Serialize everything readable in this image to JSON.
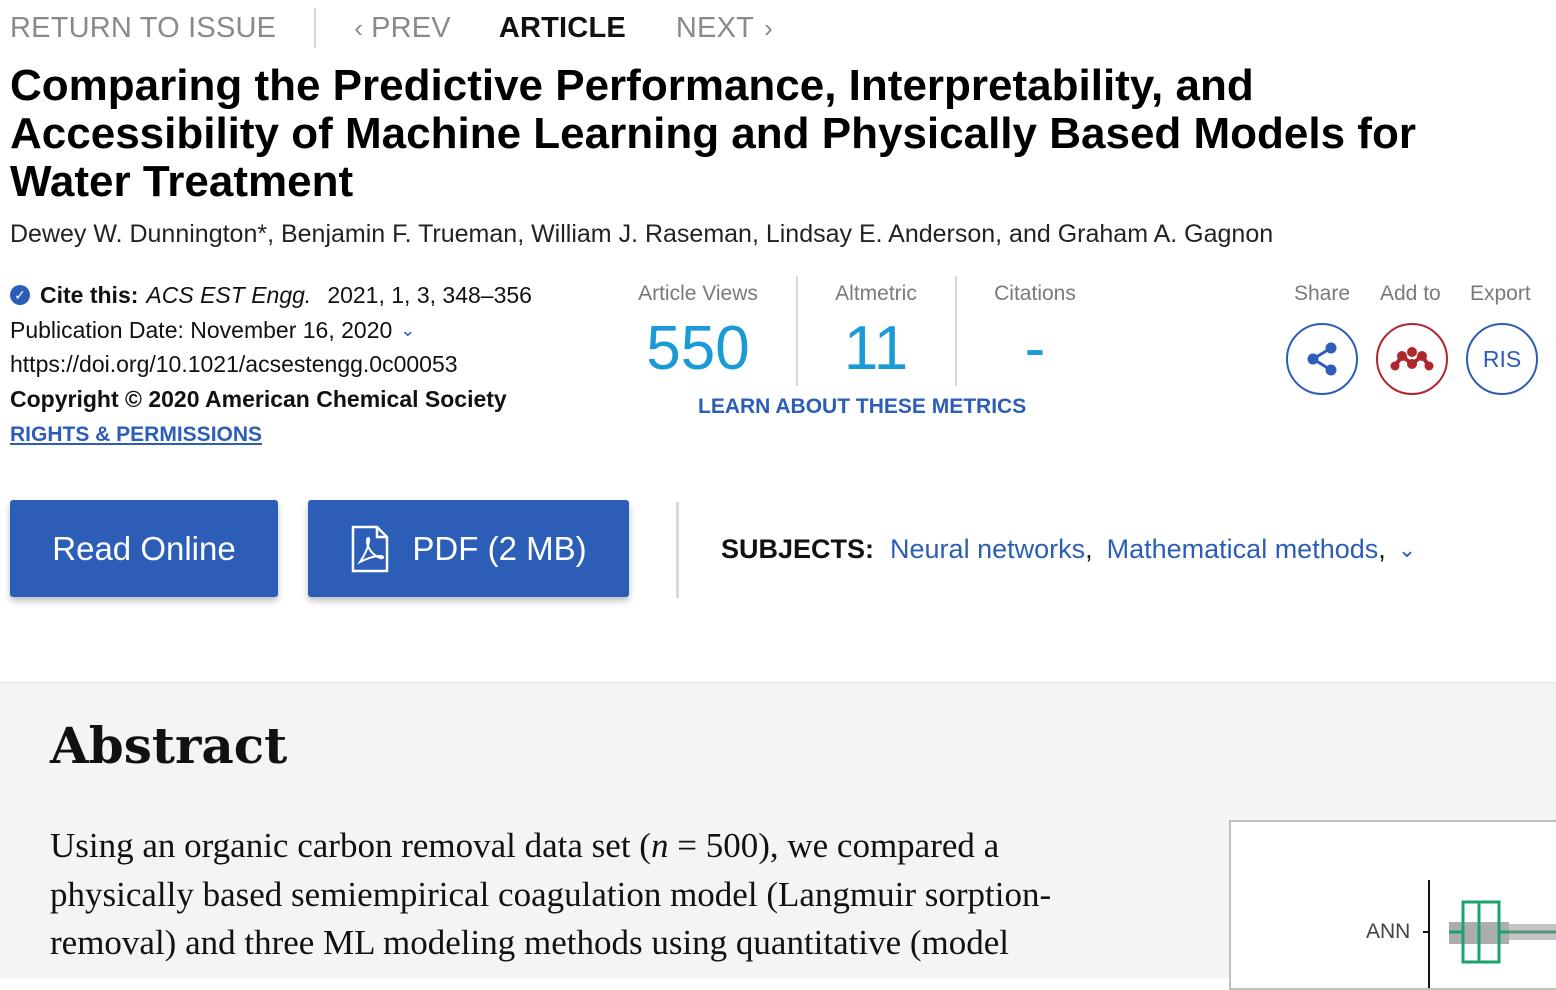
{
  "nav": {
    "return": "RETURN TO ISSUE",
    "prev": "PREV",
    "article": "ARTICLE",
    "next": "NEXT"
  },
  "title": "Comparing the Predictive Performance, Interpretability, and Accessibility of Machine Learning and Physically Based Models for Water Treatment",
  "authors": "Dewey W. Dunnington*, Benjamin F. Trueman, William J. Raseman, Lindsay E. Anderson, and Graham A. Gagnon",
  "cite": {
    "label": "Cite this:",
    "journal": "ACS EST Engg.",
    "volume_info": "2021, 1, 3, 348–356",
    "pub_date": "Publication Date: November 16, 2020",
    "doi": "https://doi.org/10.1021/acsestengg.0c00053",
    "copyright": "Copyright © 2020 American Chemical Society",
    "rights": "RIGHTS & PERMISSIONS"
  },
  "metrics": {
    "views_label": "Article Views",
    "views_value": "550",
    "altmetric_label": "Altmetric",
    "altmetric_value": "11",
    "citations_label": "Citations",
    "citations_value": "-",
    "learn": "LEARN ABOUT THESE METRICS"
  },
  "tools": {
    "share": "Share",
    "add_to": "Add to",
    "export": "Export",
    "ris": "RIS"
  },
  "buttons": {
    "read_online": "Read Online",
    "pdf": "PDF (2 MB)"
  },
  "subjects": {
    "label": "SUBJECTS:",
    "items": [
      "Neural networks",
      "Mathematical methods"
    ]
  },
  "abstract": {
    "heading": "Abstract",
    "line1a": "Using an organic carbon removal data set (",
    "line1n": "n",
    "line1b": " = 500), we compared a",
    "line2": "physically based semiempirical coagulation model (Langmuir sorption-",
    "line3": "removal) and three ML modeling methods using quantitative (model"
  },
  "graphic": {
    "axis_label": "ANN"
  },
  "colors": {
    "brand_blue": "#2c5eb7",
    "metric_blue": "#1a9ad6",
    "mendeley_red": "#b0262d"
  }
}
